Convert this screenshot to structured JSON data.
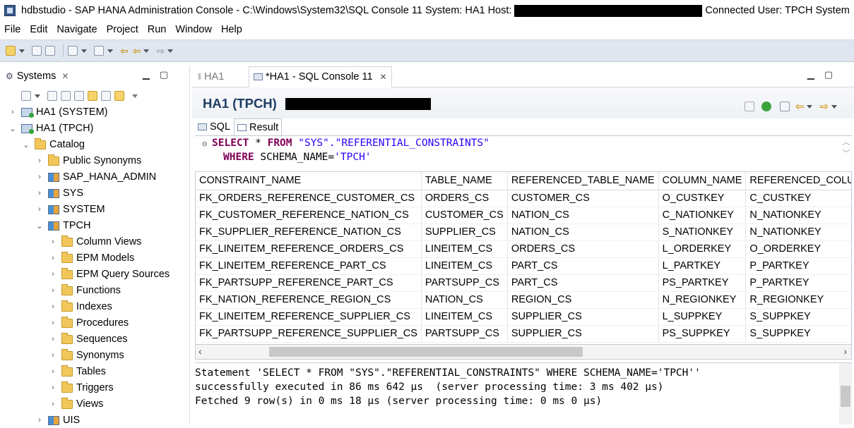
{
  "window": {
    "title_left": "hdbstudio - SAP HANA Administration Console - C:\\Windows\\System32\\SQL Console 11 System: HA1 Host:",
    "title_right": "Connected User: TPCH System"
  },
  "menu": [
    "File",
    "Edit",
    "Navigate",
    "Project",
    "Run",
    "Window",
    "Help"
  ],
  "systems_view": {
    "title": "Systems",
    "tree": [
      {
        "label": "HA1 (SYSTEM)",
        "level": 0,
        "twisty": "collapsed",
        "icon": "system-icon"
      },
      {
        "label": "HA1 (TPCH)",
        "level": 0,
        "twisty": "expanded",
        "icon": "system-icon"
      },
      {
        "label": "Catalog",
        "level": 1,
        "twisty": "expanded",
        "icon": "folder-icon"
      },
      {
        "label": "Public Synonyms",
        "level": 2,
        "twisty": "collapsed",
        "icon": "folder-icon"
      },
      {
        "label": "SAP_HANA_ADMIN",
        "level": 2,
        "twisty": "collapsed",
        "icon": "schema-icon"
      },
      {
        "label": "SYS",
        "level": 2,
        "twisty": "collapsed",
        "icon": "schema-icon"
      },
      {
        "label": "SYSTEM",
        "level": 2,
        "twisty": "collapsed",
        "icon": "schema-icon"
      },
      {
        "label": "TPCH",
        "level": 2,
        "twisty": "expanded",
        "icon": "schema-icon"
      },
      {
        "label": "Column Views",
        "level": 3,
        "twisty": "collapsed",
        "icon": "folder-icon"
      },
      {
        "label": "EPM Models",
        "level": 3,
        "twisty": "collapsed",
        "icon": "folder-icon"
      },
      {
        "label": "EPM Query Sources",
        "level": 3,
        "twisty": "collapsed",
        "icon": "folder-icon"
      },
      {
        "label": "Functions",
        "level": 3,
        "twisty": "collapsed",
        "icon": "folder-icon"
      },
      {
        "label": "Indexes",
        "level": 3,
        "twisty": "collapsed",
        "icon": "folder-icon"
      },
      {
        "label": "Procedures",
        "level": 3,
        "twisty": "collapsed",
        "icon": "folder-icon"
      },
      {
        "label": "Sequences",
        "level": 3,
        "twisty": "collapsed",
        "icon": "folder-icon"
      },
      {
        "label": "Synonyms",
        "level": 3,
        "twisty": "collapsed",
        "icon": "folder-icon"
      },
      {
        "label": "Tables",
        "level": 3,
        "twisty": "collapsed",
        "icon": "folder-icon"
      },
      {
        "label": "Triggers",
        "level": 3,
        "twisty": "collapsed",
        "icon": "folder-icon"
      },
      {
        "label": "Views",
        "level": 3,
        "twisty": "collapsed",
        "icon": "folder-icon"
      },
      {
        "label": "UIS",
        "level": 2,
        "twisty": "collapsed",
        "icon": "schema-icon"
      }
    ]
  },
  "editor": {
    "tabs": [
      {
        "label": "HA1",
        "active": false
      },
      {
        "label": "*HA1 - SQL Console 11",
        "active": true
      }
    ],
    "header_title": "HA1 (TPCH)",
    "subtabs": [
      "SQL",
      "Result"
    ],
    "sql": {
      "line1_kw1": "SELECT",
      "line1_mid": " * ",
      "line1_kw2": "FROM",
      "line1_str": " \"SYS\".\"REFERENTIAL_CONSTRAINTS\"",
      "line2_kw": "WHERE",
      "line2_rest": " SCHEMA_NAME=",
      "line2_str": "'TPCH'"
    },
    "result": {
      "columns": [
        "CONSTRAINT_NAME",
        "TABLE_NAME",
        "REFERENCED_TABLE_NAME",
        "COLUMN_NAME",
        "REFERENCED_COLUMN_NAME"
      ],
      "rows": [
        [
          "FK_ORDERS_REFERENCE_CUSTOMER_CS",
          "ORDERS_CS",
          "CUSTOMER_CS",
          "O_CUSTKEY",
          "C_CUSTKEY"
        ],
        [
          "FK_CUSTOMER_REFERENCE_NATION_CS",
          "CUSTOMER_CS",
          "NATION_CS",
          "C_NATIONKEY",
          "N_NATIONKEY"
        ],
        [
          "FK_SUPPLIER_REFERENCE_NATION_CS",
          "SUPPLIER_CS",
          "NATION_CS",
          "S_NATIONKEY",
          "N_NATIONKEY"
        ],
        [
          "FK_LINEITEM_REFERENCE_ORDERS_CS",
          "LINEITEM_CS",
          "ORDERS_CS",
          "L_ORDERKEY",
          "O_ORDERKEY"
        ],
        [
          "FK_LINEITEM_REFERENCE_PART_CS",
          "LINEITEM_CS",
          "PART_CS",
          "L_PARTKEY",
          "P_PARTKEY"
        ],
        [
          "FK_PARTSUPP_REFERENCE_PART_CS",
          "PARTSUPP_CS",
          "PART_CS",
          "PS_PARTKEY",
          "P_PARTKEY"
        ],
        [
          "FK_NATION_REFERENCE_REGION_CS",
          "NATION_CS",
          "REGION_CS",
          "N_REGIONKEY",
          "R_REGIONKEY"
        ],
        [
          "FK_LINEITEM_REFERENCE_SUPPLIER_CS",
          "LINEITEM_CS",
          "SUPPLIER_CS",
          "L_SUPPKEY",
          "S_SUPPKEY"
        ],
        [
          "FK_PARTSUPP_REFERENCE_SUPPLIER_CS",
          "PARTSUPP_CS",
          "SUPPLIER_CS",
          "PS_SUPPKEY",
          "S_SUPPKEY"
        ]
      ]
    },
    "console": [
      "Statement 'SELECT * FROM \"SYS\".\"REFERENTIAL_CONSTRAINTS\" WHERE SCHEMA_NAME='TPCH''",
      "successfully executed in 86 ms 642 µs  (server processing time: 3 ms 402 µs)",
      "Fetched 9 row(s) in 0 ms 18 µs (server processing time: 0 ms 0 µs)"
    ]
  },
  "colors": {
    "keyword": "#7f0055",
    "string": "#2a00ff",
    "header_title": "#1f3c63",
    "toolbar_bg": "#dfe6f0"
  }
}
